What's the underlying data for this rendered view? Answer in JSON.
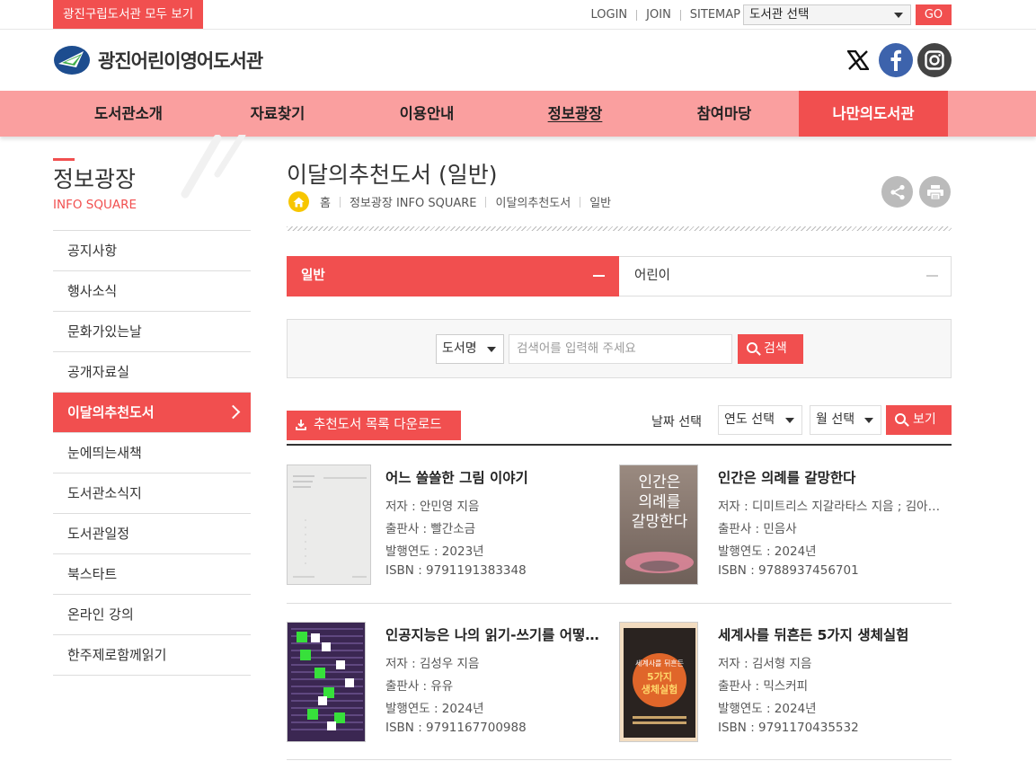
{
  "topbar": {
    "all_libraries": "광진구립도서관 모두 보기",
    "links": [
      "LOGIN",
      "JOIN",
      "SITEMAP"
    ],
    "library_select": "도서관 선택",
    "go": "GO"
  },
  "header": {
    "logo_text": "광진어린이영어도서관"
  },
  "nav": {
    "items": [
      "도서관소개",
      "자료찾기",
      "이용안내",
      "정보광장",
      "참여마당",
      "나만의도서관"
    ]
  },
  "sidebar": {
    "title": "정보광장",
    "subtitle": "INFO SQUARE",
    "items": [
      "공지사항",
      "행사소식",
      "문화가있는날",
      "공개자료실",
      "이달의추천도서",
      "눈에띄는새책",
      "도서관소식지",
      "도서관일정",
      "북스타트",
      "온라인 강의",
      "한주제로함께읽기"
    ]
  },
  "content": {
    "page_title": "이달의추천도서 (일반)",
    "breadcrumb": [
      "홈",
      "정보광장 INFO SQUARE",
      "이달의추천도서",
      "일반"
    ],
    "tabs": [
      "일반",
      "어린이"
    ],
    "search": {
      "field": "도서명",
      "placeholder": "검색어를 입력해 주세요",
      "button": "검색"
    },
    "download_button": "추천도서 목록 다운로드",
    "date_label": "날짜 선택",
    "year_select": "연도 선택",
    "month_select": "월 선택",
    "view_button": "보기"
  },
  "books": [
    {
      "title": "어느 쓸쓸한 그림 이야기",
      "author": "저자 : 안민영 지음",
      "publisher": "출판사 : 빨간소금",
      "year": "발행연도 : 2023년",
      "isbn": "ISBN : 9791191383348",
      "cover_text": "어느 쓸쓸한 그림 이야기"
    },
    {
      "title": "인간은 의례를 갈망한다",
      "author": "저자 : 디미트리스 지갈라타스 지음 ; 김아림 옮김",
      "publisher": "출판사 : 민음사",
      "year": "발행연도 : 2024년",
      "isbn": "ISBN : 9788937456701",
      "cover_text": "인간은 의례를 갈망한다"
    },
    {
      "title": "인공지능은 나의 읽기-쓰기를 어떻게 바꿀까",
      "author": "저자 : 김성우 지음",
      "publisher": "출판사 : 유유",
      "year": "발행연도 : 2024년",
      "isbn": "ISBN : 9791167700988",
      "cover_text": ""
    },
    {
      "title": "세계사를 뒤흔든 5가지 생체실험",
      "author": "저자 : 김서형 지음",
      "publisher": "출판사 : 믹스커피",
      "year": "발행연도 : 2024년",
      "isbn": "ISBN : 9791170435532",
      "cover_text": "세계사를 뒤흔든 5가지 생체실험"
    }
  ],
  "colors": {
    "accent": "#f14f4f",
    "nav_bg": "#fa9f9f",
    "facebook": "#3d63ac",
    "home_icon": "#f7c600"
  }
}
